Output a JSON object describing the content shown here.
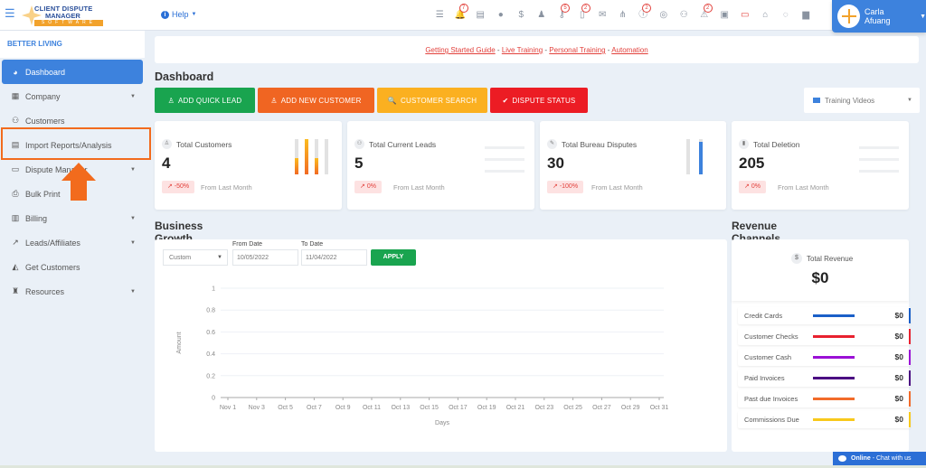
{
  "header": {
    "logo": {
      "line1": "CLIENT DISPUTE",
      "line2": "MANAGER",
      "line3": "SOFTWARE"
    },
    "help_label": "Help",
    "icons": [
      {
        "name": "tasks-icon",
        "glyph": "☰",
        "badge": null
      },
      {
        "name": "bell-icon",
        "glyph": "🔔",
        "badge": "7"
      },
      {
        "name": "invoice-icon",
        "glyph": "▤",
        "badge": null
      },
      {
        "name": "agent-icon",
        "glyph": "●",
        "badge": null
      },
      {
        "name": "dollar-icon",
        "glyph": "$",
        "badge": null
      },
      {
        "name": "user-tie-icon",
        "glyph": "♟",
        "badge": null
      },
      {
        "name": "key-icon",
        "glyph": "⚷",
        "badge": "5"
      },
      {
        "name": "document-icon",
        "glyph": "▯",
        "badge": "2"
      },
      {
        "name": "envelope-icon",
        "glyph": "✉",
        "badge": null
      },
      {
        "name": "sitemap-icon",
        "glyph": "⋔",
        "badge": null
      },
      {
        "name": "info-icon",
        "glyph": "ⓘ",
        "badge": "2"
      },
      {
        "name": "globe-icon",
        "glyph": "◎",
        "badge": null
      },
      {
        "name": "users-icon",
        "glyph": "⚇",
        "badge": null
      },
      {
        "name": "warning-icon",
        "glyph": "⚠",
        "badge": "2"
      },
      {
        "name": "inbox-icon",
        "glyph": "▣",
        "badge": null
      },
      {
        "name": "money-icon",
        "glyph": "▭",
        "badge": null
      },
      {
        "name": "tray-icon",
        "glyph": "⌂",
        "badge": null
      },
      {
        "name": "comments-icon",
        "glyph": "◌",
        "badge": null
      },
      {
        "name": "copy-icon",
        "glyph": "▆",
        "badge": null
      }
    ],
    "user_name": "Carla Afuang"
  },
  "sidebar": {
    "company": "BETTER LIVING",
    "items": [
      {
        "label": "Dashboard",
        "icon": "◕",
        "icon_name": "chart-pie-icon",
        "active": true,
        "has_submenu": false
      },
      {
        "label": "Company",
        "icon": "▦",
        "icon_name": "building-icon",
        "active": false,
        "has_submenu": true
      },
      {
        "label": "Customers",
        "icon": "⚇",
        "icon_name": "users-icon",
        "active": false,
        "has_submenu": false
      },
      {
        "label": "Import Reports/Analysis",
        "icon": "▤",
        "icon_name": "file-import-icon",
        "active": false,
        "has_submenu": false
      },
      {
        "label": "Dispute Manager",
        "icon": "▭",
        "icon_name": "laptop-icon",
        "active": false,
        "has_submenu": true
      },
      {
        "label": "Bulk Print",
        "icon": "⎙",
        "icon_name": "printer-icon",
        "active": false,
        "has_submenu": false
      },
      {
        "label": "Billing",
        "icon": "▥",
        "icon_name": "billing-icon",
        "active": false,
        "has_submenu": true
      },
      {
        "label": "Leads/Affiliates",
        "icon": "↗",
        "icon_name": "chart-line-icon",
        "active": false,
        "has_submenu": true
      },
      {
        "label": "Get Customers",
        "icon": "◭",
        "icon_name": "graduation-cap-icon",
        "active": false,
        "has_submenu": false
      },
      {
        "label": "Resources",
        "icon": "♜",
        "icon_name": "resources-icon",
        "active": false,
        "has_submenu": true
      }
    ]
  },
  "links": [
    "Getting Started Guide",
    "Live Training",
    "Personal Training",
    "Automation"
  ],
  "links_separator": " - ",
  "dashboard_title": "Dashboard",
  "actions": [
    {
      "label": "ADD QUICK LEAD",
      "icon": "♙",
      "color": "#19a44f"
    },
    {
      "label": "ADD NEW CUSTOMER",
      "icon": "♙",
      "color": "#f06522"
    },
    {
      "label": "CUSTOMER SEARCH",
      "icon": "🔍",
      "color": "#fbb020"
    },
    {
      "label": "DISPUTE STATUS",
      "icon": "✔",
      "color": "#ec1c24"
    }
  ],
  "training_videos": "Training Videos",
  "stats": [
    {
      "label": "Total Customers",
      "value": "4",
      "change": "-50%",
      "sub": "From Last Month",
      "icon": "♙",
      "fills": [
        0.45,
        1.0,
        0.45,
        0.0
      ]
    },
    {
      "label": "Total Current Leads",
      "value": "5",
      "change": "0%",
      "sub": "From Last Month",
      "icon": "⚇"
    },
    {
      "label": "Total Bureau Disputes",
      "value": "30",
      "change": "-100%",
      "sub": "From Last Month",
      "icon": "✎",
      "fills": [
        0.0,
        0.92
      ]
    },
    {
      "label": "Total Deletion",
      "value": "205",
      "change": "0%",
      "sub": "From Last Month",
      "icon": "▮"
    }
  ],
  "growth": {
    "title": "Business Growth Statistics",
    "range_select": "Custom",
    "from_label": "From Date",
    "from_value": "10/05/2022",
    "to_label": "To Date",
    "to_value": "11/04/2022",
    "apply_label": "APPLY"
  },
  "chart_data": {
    "type": "line",
    "title": "",
    "xlabel": "Days",
    "ylabel": "Amount",
    "x": [
      "Nov 1",
      "Nov 3",
      "Oct 5",
      "Oct 7",
      "Oct 9",
      "Oct 11",
      "Oct 13",
      "Oct 15",
      "Oct 17",
      "Oct 19",
      "Oct 21",
      "Oct 23",
      "Oct 25",
      "Oct 27",
      "Oct 29",
      "Oct 31"
    ],
    "yticks": [
      "0",
      "0.2",
      "0.4",
      "0.6",
      "0.8",
      "1"
    ],
    "ylim": [
      0,
      1
    ],
    "series": [],
    "grid": true
  },
  "revenue": {
    "title": "Revenue Channels",
    "total_label": "Total Revenue",
    "total_value": "$0",
    "channels": [
      {
        "label": "Credit Cards",
        "value": "$0",
        "color": "#1a5fc8"
      },
      {
        "label": "Customer Checks",
        "value": "$0",
        "color": "#e8212f"
      },
      {
        "label": "Customer Cash",
        "value": "$0",
        "color": "#9b10d6"
      },
      {
        "label": "Paid Invoices",
        "value": "$0",
        "color": "#4b0a82"
      },
      {
        "label": "Past due Invoices",
        "value": "$0",
        "color": "#f26b2a"
      },
      {
        "label": "Commissions Due",
        "value": "$0",
        "color": "#f8c91b"
      }
    ]
  },
  "chat": {
    "status": "Online",
    "text": " - Chat with us"
  }
}
